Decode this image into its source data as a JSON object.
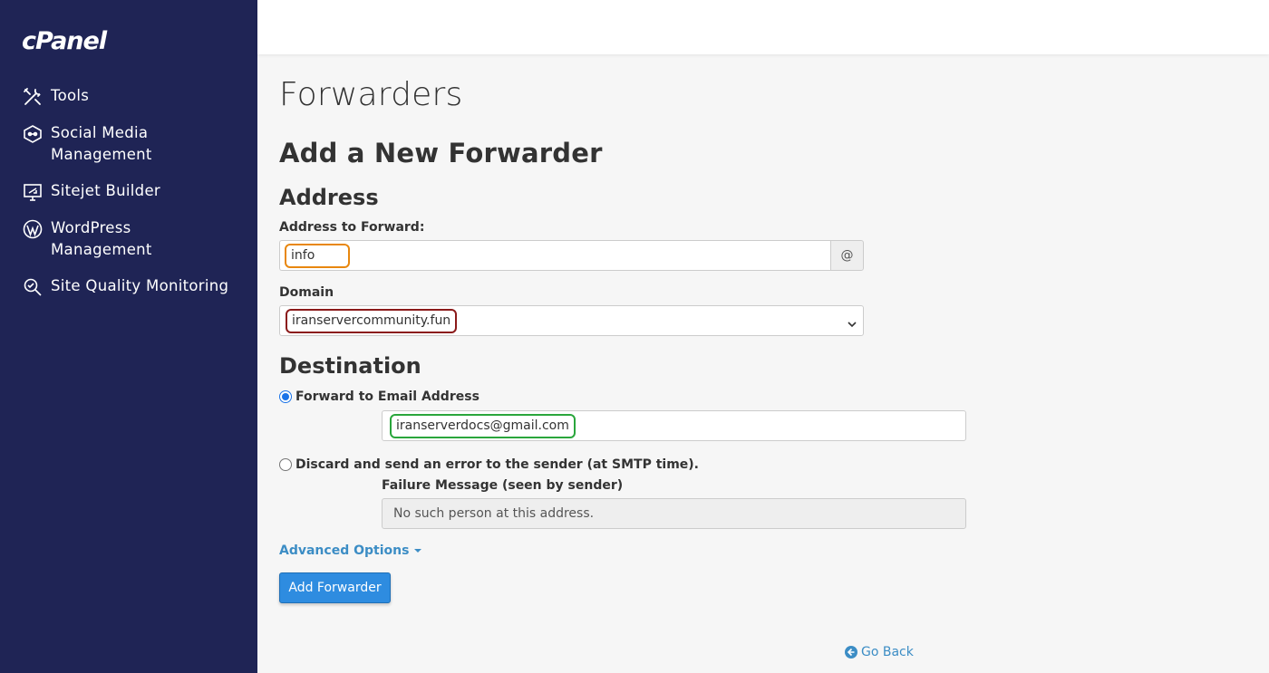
{
  "app": {
    "logo": "cPanel"
  },
  "sidebar": {
    "items": [
      {
        "label": "Tools",
        "icon": "tools-icon"
      },
      {
        "label": "Social Media\nManagement",
        "label_line1": "Social Media",
        "label_line2": "Management",
        "icon": "social-media-icon"
      },
      {
        "label": "Sitejet Builder",
        "icon": "sitejet-icon"
      },
      {
        "label": "WordPress Management",
        "icon": "wordpress-icon"
      },
      {
        "label": "Site Quality Monitoring",
        "icon": "site-quality-icon"
      }
    ]
  },
  "page": {
    "title": "Forwarders",
    "section_title": "Add a New Forwarder",
    "address_heading": "Address",
    "address_label": "Address to Forward:",
    "address_value": "info",
    "at_symbol": "@",
    "domain_label": "Domain",
    "domain_value": "iranservercommunity.fun",
    "destination_heading": "Destination",
    "forward_label": "Forward to Email Address",
    "forward_value": "iranserverdocs@gmail.com",
    "discard_label": "Discard and send an error to the sender (at SMTP time).",
    "failure_label": "Failure Message (seen by sender)",
    "failure_value": "No such person at this address.",
    "advanced_options": "Advanced Options",
    "add_button": "Add Forwarder",
    "go_back": "Go Back"
  },
  "colors": {
    "sidebar_bg": "#1f2455",
    "link": "#3c8dc5",
    "primary_button": "#2e8ce0",
    "highlight_address": "#e8870e",
    "highlight_domain": "#8b1a1a",
    "highlight_email": "#2aa63c"
  }
}
